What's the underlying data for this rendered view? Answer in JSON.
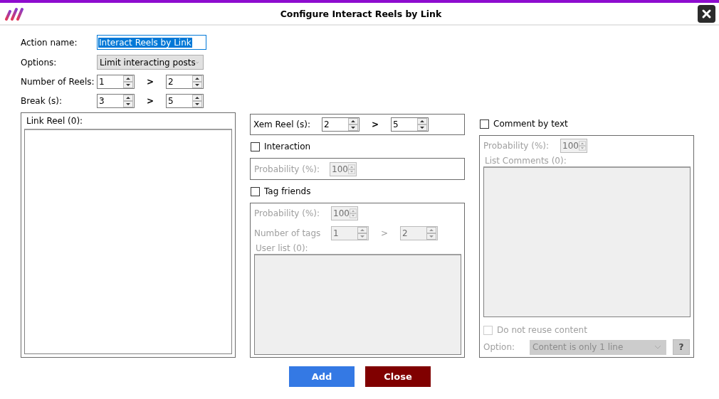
{
  "window": {
    "title": "Configure Interact Reels by Link"
  },
  "action_name": {
    "label": "Action name:",
    "value": "Interact Reels by Link",
    "highlighted": true
  },
  "options": {
    "label": "Options:",
    "value": "Limit interacting posts"
  },
  "number_of_reels": {
    "label": "Number of Reels:",
    "from": "1",
    "separator": ">",
    "to": "2"
  },
  "break": {
    "label": "Break (s):",
    "from": "3",
    "separator": ">",
    "to": "5"
  },
  "link_reel": {
    "label": "Link Reel (0):"
  },
  "xem_reel": {
    "label": "Xem Reel (s):",
    "from": "2",
    "separator": ">",
    "to": "5"
  },
  "interaction": {
    "label": "Interaction",
    "checked": false,
    "probability": {
      "label": "Probability (%):",
      "value": "100"
    }
  },
  "tag_friends": {
    "label": "Tag friends",
    "checked": false,
    "probability": {
      "label": "Probability (%):",
      "value": "100"
    },
    "number_of_tags": {
      "label": "Number of tags",
      "from": "1",
      "separator": ">",
      "to": "2"
    },
    "user_list": {
      "label": "User list (0):"
    }
  },
  "comment_by_text": {
    "label": "Comment by text",
    "checked": false,
    "probability": {
      "label": "Probability (%):",
      "value": "100"
    },
    "list_comments": {
      "label": "List Comments (0):"
    },
    "do_not_reuse": {
      "label": "Do not reuse content",
      "checked": false
    },
    "option": {
      "label": "Option:",
      "value": "Content is only 1 line"
    },
    "help": "?"
  },
  "buttons": [
    {
      "label": "Add",
      "kind": "primary"
    },
    {
      "label": "Close",
      "kind": "danger"
    }
  ]
}
